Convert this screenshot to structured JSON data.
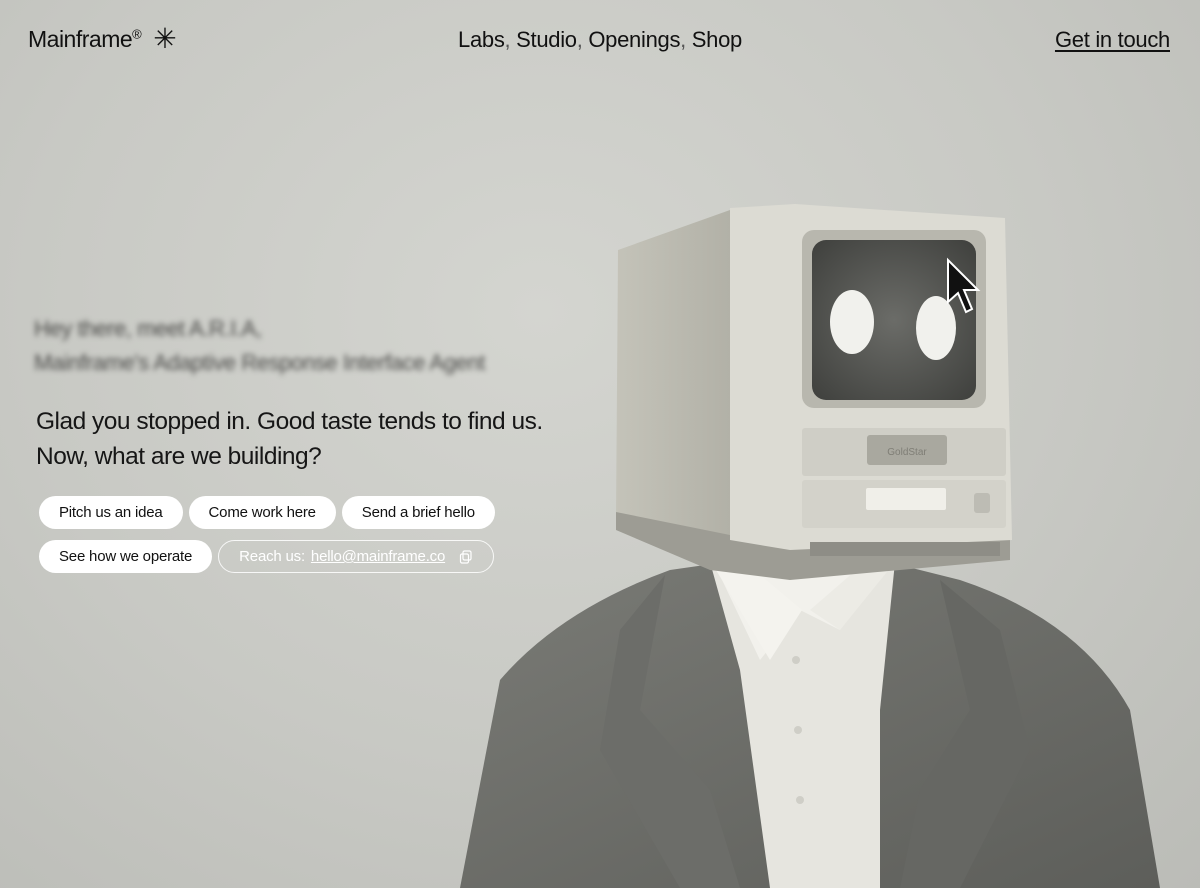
{
  "brand": {
    "name": "Mainframe",
    "mark": "®",
    "symbol": "✳"
  },
  "nav": {
    "items": [
      "Labs",
      "Studio",
      "Openings",
      "Shop"
    ],
    "separator": ","
  },
  "header": {
    "cta_label": "Get in touch"
  },
  "intro": {
    "line1": "Hey there, meet A.R.I.A,",
    "line2": "Mainframe's Adaptive Response Interface Agent"
  },
  "headline": {
    "line1": "Glad you stopped in. Good taste tends to find us.",
    "line2": "Now, what are we building?"
  },
  "chips": {
    "pitch": "Pitch us an idea",
    "work": "Come work here",
    "hello": "Send a brief hello",
    "operate": "See how we operate",
    "reach_prefix": "Reach us:",
    "email": "hello@mainframe.co"
  },
  "monitor": {
    "brand_label": "GoldStar"
  },
  "colors": {
    "background": "#c9cac5",
    "text": "#111111",
    "chip_bg": "#ffffff"
  }
}
